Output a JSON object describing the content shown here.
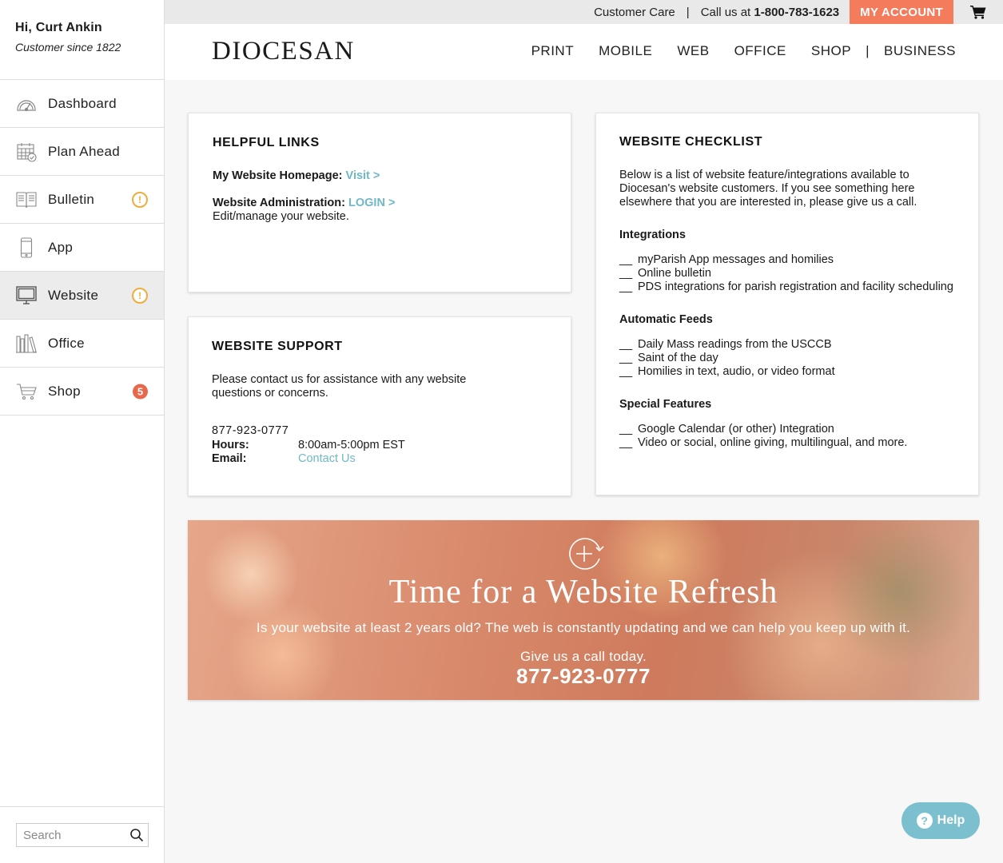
{
  "user": {
    "greeting": "Hi, Curt Ankin",
    "since": "Customer since 1822"
  },
  "sidebar": {
    "items": [
      {
        "label": "Dashboard",
        "icon": "dashboard-gauge-icon"
      },
      {
        "label": "Plan Ahead",
        "icon": "calendar-icon"
      },
      {
        "label": "Bulletin",
        "icon": "book-icon",
        "badge": "!"
      },
      {
        "label": "App",
        "icon": "phone-icon"
      },
      {
        "label": "Website",
        "icon": "monitor-icon",
        "badge": "!"
      },
      {
        "label": "Office",
        "icon": "books-icon"
      },
      {
        "label": "Shop",
        "icon": "cart-icon",
        "badge": "5"
      }
    ],
    "search_placeholder": "Search"
  },
  "topbar": {
    "customer_care": "Customer Care",
    "separator": "|",
    "call_prefix": "Call us at ",
    "call_number": "1-800-783-1623",
    "my_account": "MY ACCOUNT"
  },
  "header": {
    "logo": "DIOCESAN",
    "nav": [
      "PRINT",
      "MOBILE",
      "WEB",
      "OFFICE",
      "SHOP",
      "|",
      "BUSINESS"
    ]
  },
  "helpful_links": {
    "title": "HELPFUL LINKS",
    "homepage_label": "My Website Homepage:",
    "homepage_link": "Visit >",
    "admin_label": "Website Administration:",
    "admin_link": "LOGIN >",
    "admin_desc": "Edit/manage your website."
  },
  "support": {
    "title": "WEBSITE SUPPORT",
    "desc": "Please contact us for assistance with any website questions or concerns.",
    "phone": "877-923-0777",
    "hours_label": "Hours:",
    "hours_value": "8:00am-5:00pm EST",
    "email_label": "Email:",
    "email_value": "Contact Us"
  },
  "checklist": {
    "title": "WEBSITE CHECKLIST",
    "intro": "Below is a list of website feature/integrations available to Diocesan's website customers. If you see something here elsewhere that you are interested in, please give us a call.",
    "blank": "__",
    "sections": [
      {
        "heading": "Integrations",
        "items": [
          "myParish App messages and homilies",
          "Online bulletin",
          "PDS integrations for parish registration and facility scheduling"
        ]
      },
      {
        "heading": "Automatic Feeds",
        "items": [
          "Daily Mass readings from the USCCB",
          "Saint of the day",
          "Homilies in text, audio, or video format"
        ]
      },
      {
        "heading": "Special Features",
        "items": [
          "Google Calendar (or other) Integration",
          "Video or social, online giving, multilingual, and more."
        ]
      }
    ]
  },
  "banner": {
    "title": "Time for a Website Refresh",
    "subtitle": "Is your website at least 2 years old? The web is constantly updating and we can help you keep up with it.",
    "call": "Give us a call today.",
    "phone": "877-923-0777"
  },
  "help": {
    "label": "Help",
    "q": "?"
  },
  "colors": {
    "accent": "#f47b5c",
    "teal": "#6fb8c6",
    "warn": "#f0ad3a",
    "count_badge": "#e9674b"
  }
}
